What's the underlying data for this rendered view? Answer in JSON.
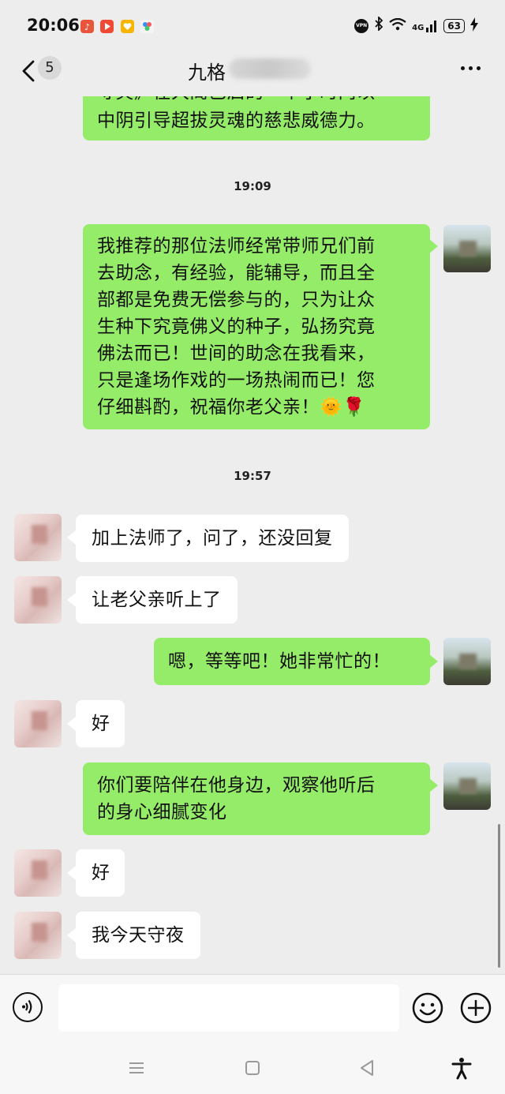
{
  "status_bar": {
    "time": "20:06",
    "network": "4G",
    "vpn_label": "VPN",
    "battery": "63",
    "icons": [
      "music-app-icon",
      "video-app-icon",
      "heart-app-icon",
      "pinwheel-app-icon",
      "vpn-icon",
      "bluetooth-icon",
      "wifi-icon",
      "signal-icon",
      "battery-icon",
      "charging-icon"
    ]
  },
  "nav": {
    "unread_count": "5",
    "title": "九格"
  },
  "messages": [
    {
      "type": "outgoing",
      "text_lines": [
        "寻笑》在大阁已启的一个小时内以",
        "中阴引导超拔灵魂的慈悲威德力。"
      ]
    },
    {
      "type": "time",
      "text": "19:09"
    },
    {
      "type": "outgoing",
      "text_lines": [
        "我推荐的那位法师经常带师兄们前",
        "去助念，有经验，能辅导，而且全",
        "部都是免费无偿参与的，只为让众",
        "生种下究竟佛义的种子，弘扬究竟",
        "佛法而已！世间的助念在我看来，",
        "只是逢场作戏的一场热闹而已！您",
        "仔细斟酌，祝福你老父亲！🌞🌹"
      ]
    },
    {
      "type": "time",
      "text": "19:57"
    },
    {
      "type": "incoming",
      "text": "加上法师了，问了，还没回复"
    },
    {
      "type": "incoming",
      "text": "让老父亲听上了"
    },
    {
      "type": "outgoing",
      "text": "嗯，等等吧！她非常忙的！"
    },
    {
      "type": "incoming",
      "text": "好"
    },
    {
      "type": "outgoing",
      "text_lines": [
        "你们要陪伴在他身边，观察他听后",
        "的身心细腻变化"
      ]
    },
    {
      "type": "incoming",
      "text": "好"
    },
    {
      "type": "incoming",
      "text": "我今天守夜"
    }
  ],
  "input": {
    "placeholder": "",
    "value": ""
  },
  "colors": {
    "outgoing_bubble": "#95ec69",
    "incoming_bubble": "#ffffff",
    "background": "#ededed"
  }
}
